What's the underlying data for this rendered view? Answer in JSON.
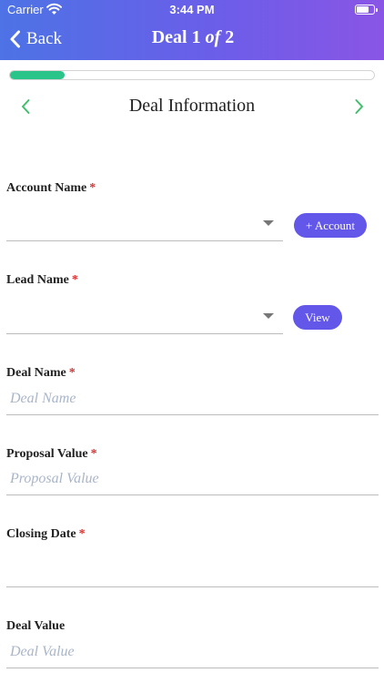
{
  "status_bar": {
    "carrier": "Carrier",
    "time": "3:44 PM"
  },
  "nav": {
    "back_label": "Back",
    "title_prefix": "Deal 1",
    "title_of": "of",
    "title_total": "2"
  },
  "progress": {
    "fraction": 0.15,
    "color": "#29c48a"
  },
  "section": {
    "title": "Deal Information"
  },
  "fields": {
    "account_name": {
      "label": "Account Name",
      "required": "*",
      "value": "",
      "action_label": "+ Account"
    },
    "lead_name": {
      "label": "Lead Name",
      "required": "*",
      "value": "",
      "action_label": "View"
    },
    "deal_name": {
      "label": "Deal Name",
      "required": "*",
      "placeholder": "Deal Name",
      "value": ""
    },
    "proposal_value": {
      "label": "Proposal Value",
      "required": "*",
      "placeholder": "Proposal Value",
      "value": ""
    },
    "closing_date": {
      "label": "Closing Date",
      "required": "*",
      "value": ""
    },
    "deal_value": {
      "label": "Deal Value",
      "placeholder": "Deal Value",
      "value": ""
    }
  },
  "colors": {
    "header_start": "#4d73e6",
    "header_end": "#8a55e6",
    "pill": "#6357ea",
    "required": "#d63232",
    "chevron": "#3fbf6a"
  }
}
